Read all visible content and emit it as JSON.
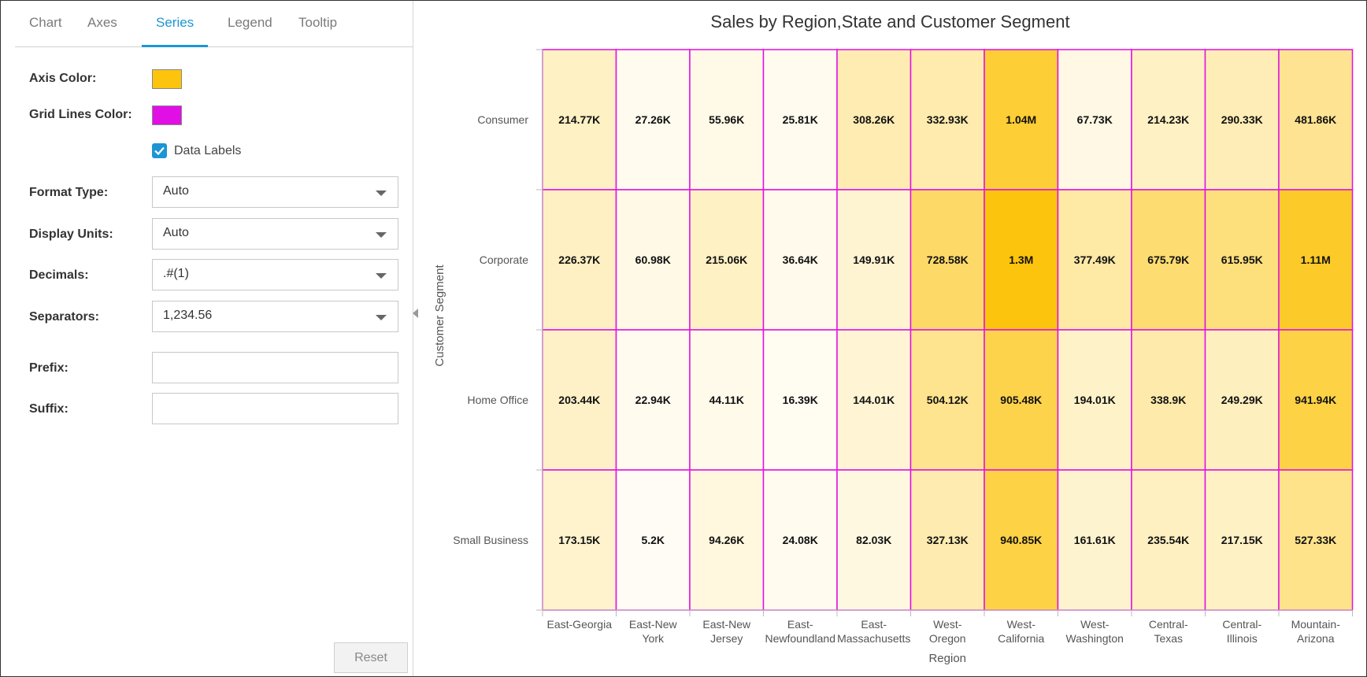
{
  "tabs": [
    {
      "label": "Chart",
      "active": false
    },
    {
      "label": "Axes",
      "active": false
    },
    {
      "label": "Series",
      "active": true
    },
    {
      "label": "Legend",
      "active": false
    },
    {
      "label": "Tooltip",
      "active": false
    }
  ],
  "form": {
    "axis_color_label": "Axis Color:",
    "axis_color": "#fcc40d",
    "grid_lines_color_label": "Grid Lines Color:",
    "grid_lines_color": "#e20ee6",
    "data_labels_label": "Data Labels",
    "data_labels_checked": true,
    "format_type_label": "Format Type:",
    "format_type_value": "Auto",
    "display_units_label": "Display Units:",
    "display_units_value": "Auto",
    "decimals_label": "Decimals:",
    "decimals_value": ".#(1)",
    "separators_label": "Separators:",
    "separators_value": "1,234.56",
    "prefix_label": "Prefix:",
    "prefix_value": "",
    "suffix_label": "Suffix:",
    "suffix_value": "",
    "reset_label": "Reset"
  },
  "colors": {
    "accent": "#1d95d4",
    "heat_low": "#fffdf7",
    "heat_high": "#fcc40d",
    "grid": "#e20ee6"
  },
  "chart_data": {
    "type": "heatmap",
    "title": "Sales by Region,State and Customer Segment",
    "xlabel": "Region",
    "ylabel": "Customer Segment",
    "x_categories": [
      [
        "East-Georgia"
      ],
      [
        "East-New",
        "York"
      ],
      [
        "East-New",
        "Jersey"
      ],
      [
        "East-",
        "Newfoundland"
      ],
      [
        "East-",
        "Massachusetts"
      ],
      [
        "West-",
        "Oregon"
      ],
      [
        "West-",
        "California"
      ],
      [
        "West-",
        "Washington"
      ],
      [
        "Central-",
        "Texas"
      ],
      [
        "Central-",
        "Illinois"
      ],
      [
        "Mountain-",
        "Arizona"
      ]
    ],
    "y_categories": [
      "Consumer",
      "Corporate",
      "Home Office",
      "Small Business"
    ],
    "values": [
      [
        214770,
        27260,
        55960,
        25810,
        308260,
        332930,
        1040000,
        67730,
        214230,
        290330,
        481860
      ],
      [
        226370,
        60980,
        215060,
        36640,
        149910,
        728580,
        1300000,
        377490,
        675790,
        615950,
        1110000
      ],
      [
        203440,
        22940,
        44110,
        16390,
        144010,
        504120,
        905480,
        194010,
        338900,
        249290,
        941940
      ],
      [
        173150,
        5200,
        94260,
        24080,
        82030,
        327130,
        940850,
        161610,
        235540,
        217150,
        527330
      ]
    ],
    "labels": [
      [
        "214.77K",
        "27.26K",
        "55.96K",
        "25.81K",
        "308.26K",
        "332.93K",
        "1.04M",
        "67.73K",
        "214.23K",
        "290.33K",
        "481.86K"
      ],
      [
        "226.37K",
        "60.98K",
        "215.06K",
        "36.64K",
        "149.91K",
        "728.58K",
        "1.3M",
        "377.49K",
        "675.79K",
        "615.95K",
        "1.11M"
      ],
      [
        "203.44K",
        "22.94K",
        "44.11K",
        "16.39K",
        "144.01K",
        "504.12K",
        "905.48K",
        "194.01K",
        "338.9K",
        "249.29K",
        "941.94K"
      ],
      [
        "173.15K",
        "5.2K",
        "94.26K",
        "24.08K",
        "82.03K",
        "327.13K",
        "940.85K",
        "161.61K",
        "235.54K",
        "217.15K",
        "527.33K"
      ]
    ]
  }
}
